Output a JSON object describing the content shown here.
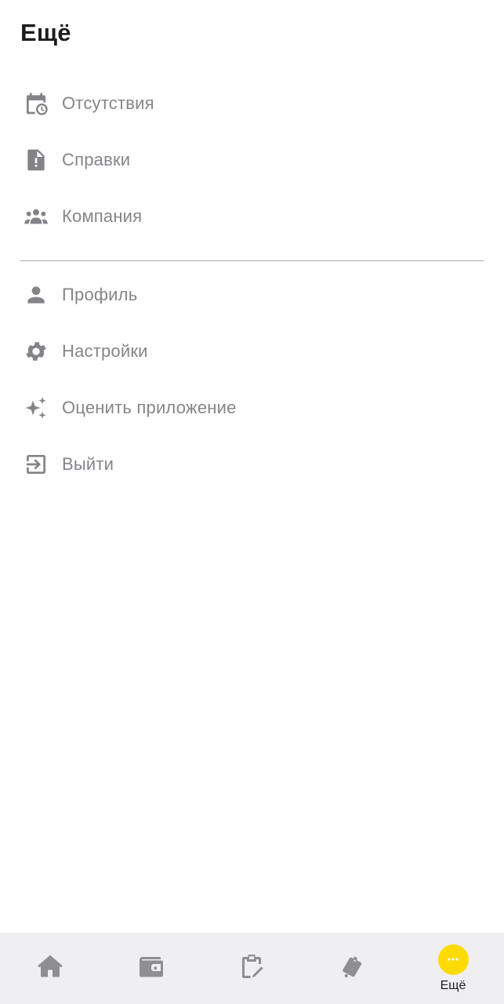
{
  "header": {
    "title": "Ещё"
  },
  "menu": {
    "group1": [
      {
        "label": "Отсутствия",
        "icon": "calendar-clock-icon"
      },
      {
        "label": "Справки",
        "icon": "document-alert-icon"
      },
      {
        "label": "Компания",
        "icon": "group-icon"
      }
    ],
    "group2": [
      {
        "label": "Профиль",
        "icon": "person-icon"
      },
      {
        "label": "Настройки",
        "icon": "gear-icon"
      },
      {
        "label": "Оценить приложение",
        "icon": "sparkle-icon"
      },
      {
        "label": "Выйти",
        "icon": "logout-icon"
      }
    ]
  },
  "bottom_nav": {
    "items": [
      {
        "icon": "home-icon"
      },
      {
        "icon": "wallet-icon"
      },
      {
        "icon": "clipboard-edit-icon"
      },
      {
        "icon": "luggage-icon"
      },
      {
        "icon": "more-icon",
        "label": "Ещё",
        "active": true
      }
    ]
  },
  "colors": {
    "accent": "#fddb00",
    "icon": "#838388",
    "text": "#85858a",
    "title": "#1d1d1f",
    "nav_bg": "#efeff1"
  }
}
